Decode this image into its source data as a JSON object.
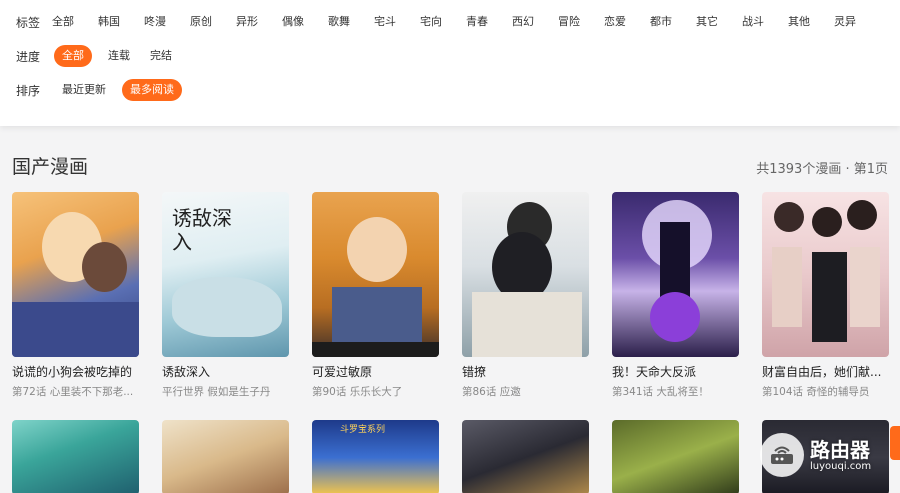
{
  "filters": {
    "tags": {
      "label": "标签",
      "items": [
        "全部",
        "韩国",
        "咚漫",
        "原创",
        "异形",
        "偶像",
        "歌舞",
        "宅斗",
        "宅向",
        "青春",
        "西幻",
        "冒险",
        "恋爱",
        "都市",
        "其它",
        "战斗",
        "其他",
        "灵异"
      ]
    },
    "progress": {
      "label": "进度",
      "items": [
        "全部",
        "连载",
        "完结"
      ],
      "active": "全部"
    },
    "sort": {
      "label": "排序",
      "items": [
        "最近更新",
        "最多阅读"
      ],
      "active": "最多阅读"
    }
  },
  "section": {
    "title": "国产漫画",
    "page_info": "共1393个漫画 · 第1页"
  },
  "comics": [
    {
      "title": "说谎的小狗会被吃掉的",
      "meta": "第72话 心里装不下那老..."
    },
    {
      "title": "诱敌深入",
      "meta": "平行世界 假如是生子丹"
    },
    {
      "title": "可爱过敏原",
      "meta": "第90话 乐乐长大了"
    },
    {
      "title": "错撩",
      "meta": "第86话 应邀"
    },
    {
      "title": "我！天命大反派",
      "meta": "第341话 大乱将至！"
    },
    {
      "title": "财富自由后，她们献...",
      "meta": "第104话 奇怪的辅导员"
    }
  ],
  "cover_lettering": {
    "c2": "诱敌深入",
    "c7": "斗罗宝系列"
  },
  "colors": {
    "accent": "#ff6a1a"
  },
  "watermark": {
    "brand": "路由器",
    "site": "luyouqi.com"
  }
}
